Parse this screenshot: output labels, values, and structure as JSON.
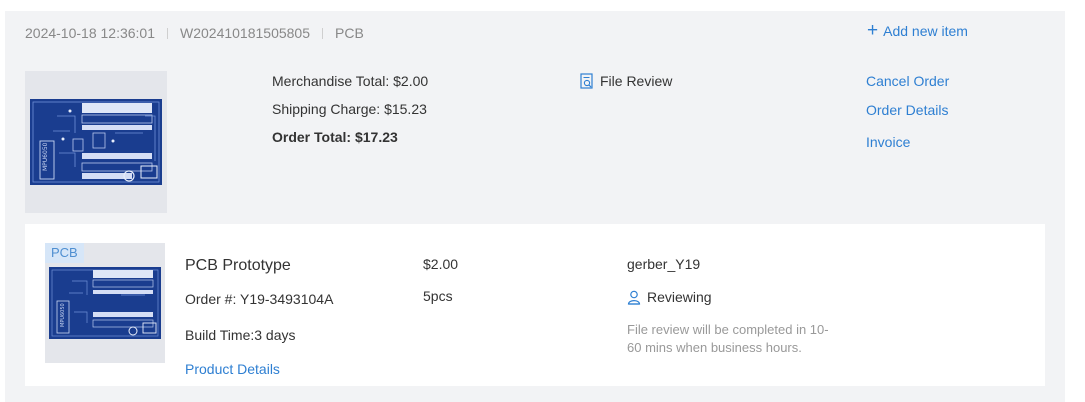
{
  "header": {
    "datetime": "2024-10-18 12:36:01",
    "order_no": "W202410181505805",
    "category": "PCB",
    "add_new_label": "Add new item"
  },
  "summary": {
    "merchandise": "Merchandise Total: $2.00",
    "shipping": "Shipping Charge: $15.23",
    "total": "Order Total: $17.23"
  },
  "file_review_label": "File Review",
  "actions": {
    "cancel": "Cancel Order",
    "details": "Order Details",
    "invoice": "Invoice"
  },
  "item": {
    "badge": "PCB",
    "name": "PCB Prototype",
    "order_number": "Order #: Y19-3493104A",
    "build_time": "Build Time:3 days",
    "details_link": "Product Details",
    "price": "$2.00",
    "quantity": "5pcs",
    "file_name": "gerber_Y19",
    "status": "Reviewing",
    "status_note": "File review will be completed in 10-60 mins when business hours."
  },
  "colors": {
    "link": "#2e7fd2",
    "card_bg": "#f2f3f5",
    "pcb_board": "#1a3d8f"
  },
  "icons": [
    "plus-icon",
    "file-review-icon",
    "user-review-icon"
  ]
}
